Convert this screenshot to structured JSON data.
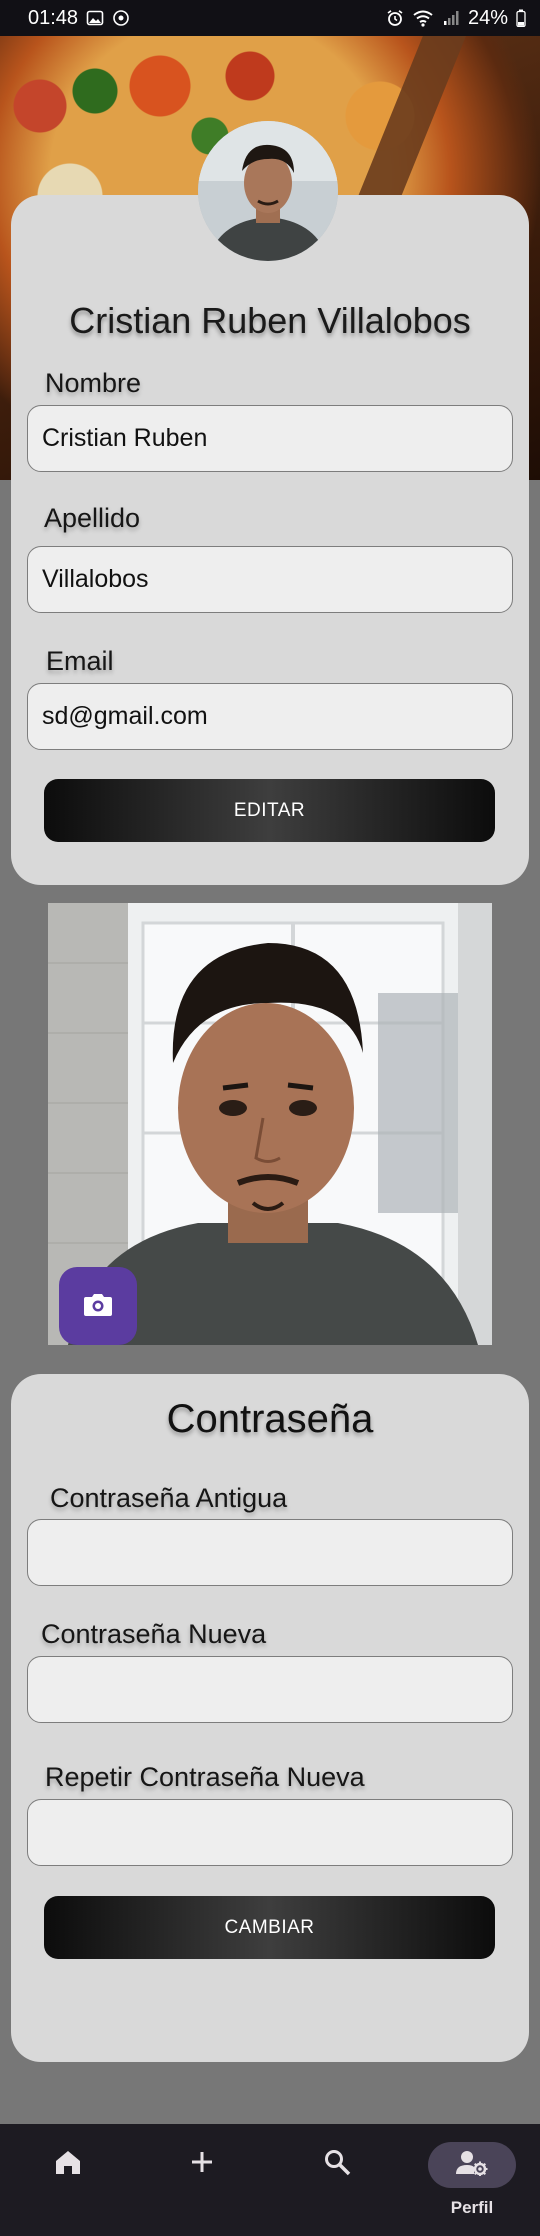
{
  "status_bar": {
    "time": "01:48",
    "battery": "24%"
  },
  "profile": {
    "full_name": "Cristian Ruben  Villalobos",
    "fields": [
      {
        "label": "Nombre",
        "value": "Cristian Ruben"
      },
      {
        "label": "Apellido",
        "value": "Villalobos"
      },
      {
        "label": "Email",
        "value": "sd@gmail.com"
      }
    ],
    "edit_button": "EDITAR"
  },
  "password": {
    "title": "Contraseña",
    "fields": [
      {
        "label": "Contraseña Antigua",
        "value": ""
      },
      {
        "label": "Contraseña Nueva",
        "value": ""
      },
      {
        "label": "Repetir Contraseña Nueva",
        "value": ""
      }
    ],
    "change_button": "CAMBIAR"
  },
  "bottom_nav": {
    "items": [
      {
        "icon": "home-icon"
      },
      {
        "icon": "add-icon"
      },
      {
        "icon": "search-icon"
      },
      {
        "icon": "profile-settings-icon",
        "label": "Perfil",
        "active": true
      }
    ]
  },
  "colors": {
    "accent_purple": "#5b3ca0",
    "card_bg": "#d9d9d9",
    "nav_bg": "#1d1b22",
    "nav_active_pill": "#4a4458"
  }
}
